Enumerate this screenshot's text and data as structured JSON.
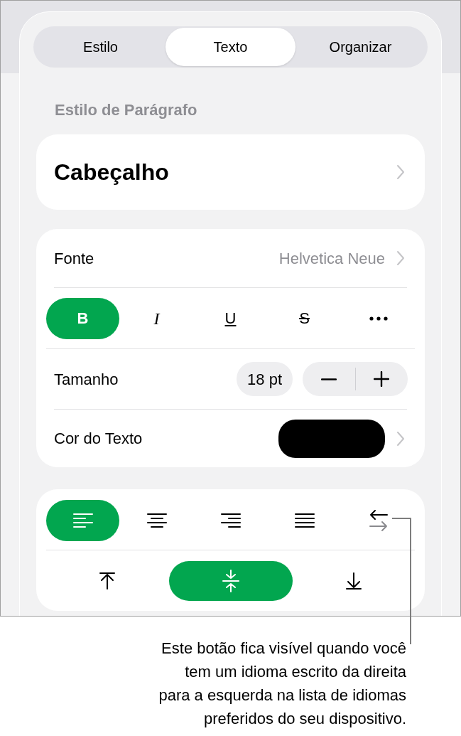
{
  "tabs": [
    {
      "label": "Estilo",
      "selected": false
    },
    {
      "label": "Texto",
      "selected": true
    },
    {
      "label": "Organizar",
      "selected": false
    }
  ],
  "section_title": "Estilo de Parágrafo",
  "paragraph_style": {
    "value": "Cabeçalho"
  },
  "font": {
    "label": "Fonte",
    "value": "Helvetica Neue"
  },
  "text_styles": [
    {
      "kind": "bold",
      "label": "B",
      "selected": true
    },
    {
      "kind": "italic",
      "label": "I",
      "selected": false
    },
    {
      "kind": "underline",
      "label": "U",
      "selected": false
    },
    {
      "kind": "strikethrough",
      "label": "S",
      "selected": false
    },
    {
      "kind": "more",
      "selected": false
    }
  ],
  "size": {
    "label": "Tamanho",
    "value": "18 pt"
  },
  "text_color": {
    "label": "Cor do Texto",
    "color": "#000000"
  },
  "alignment": [
    {
      "kind": "left",
      "selected": true
    },
    {
      "kind": "center",
      "selected": false
    },
    {
      "kind": "right",
      "selected": false
    },
    {
      "kind": "justify",
      "selected": false
    },
    {
      "kind": "rtl",
      "selected": false
    }
  ],
  "vertical_alignment": [
    {
      "kind": "top",
      "selected": false
    },
    {
      "kind": "middle",
      "selected": true
    },
    {
      "kind": "bottom",
      "selected": false
    }
  ],
  "callout": "Este botão fica visível quando você\ntem um idioma escrito da direita\npara a esquerda na lista de idiomas\npreferidos do seu dispositivo."
}
